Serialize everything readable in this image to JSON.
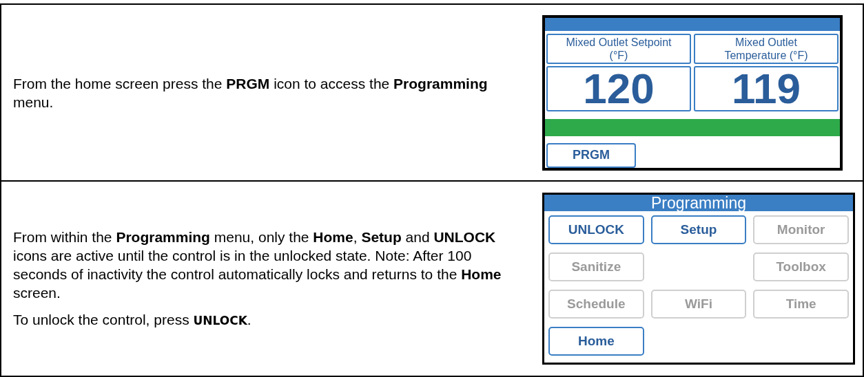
{
  "rows": [
    {
      "kind": "home",
      "paragraphs": [
        "From the home screen press the **PRGM** icon to access the **Programming**  menu."
      ],
      "screen": {
        "panels": [
          {
            "label": "Mixed Outlet Setpoint (°F)",
            "value": "120"
          },
          {
            "label": "Mixed Outlet Temperature (°F)",
            "value": "119"
          }
        ],
        "button": "PRGM"
      }
    },
    {
      "kind": "programming",
      "paragraphs": [
        "From within the **Programming** menu, only the **Home**, **Setup** and **UNLOCK** icons are active until the control is in the unlocked state. Note: After 100 seconds of inactivity the control automatically locks and returns to the **Home** screen.",
        "To unlock  the control, press **UNLOCK**."
      ],
      "screen": {
        "title": "Programming",
        "grid": [
          [
            {
              "kind": "button",
              "label": "UNLOCK",
              "active": true
            },
            {
              "kind": "button",
              "label": "Setup",
              "active": true
            },
            {
              "kind": "button",
              "label": "Monitor",
              "active": false
            }
          ],
          [
            {
              "kind": "button",
              "label": "Sanitize",
              "active": false
            },
            {
              "kind": "blank"
            },
            {
              "kind": "button",
              "label": "Toolbox",
              "active": false
            }
          ],
          [
            {
              "kind": "button",
              "label": "Schedule",
              "active": false
            },
            {
              "kind": "button",
              "label": "WiFi",
              "active": false
            },
            {
              "kind": "button",
              "label": "Time",
              "active": false
            }
          ],
          [
            {
              "kind": "button",
              "label": "Home",
              "active": true
            },
            {
              "kind": "blank"
            },
            {
              "kind": "blank"
            }
          ]
        ]
      }
    }
  ]
}
